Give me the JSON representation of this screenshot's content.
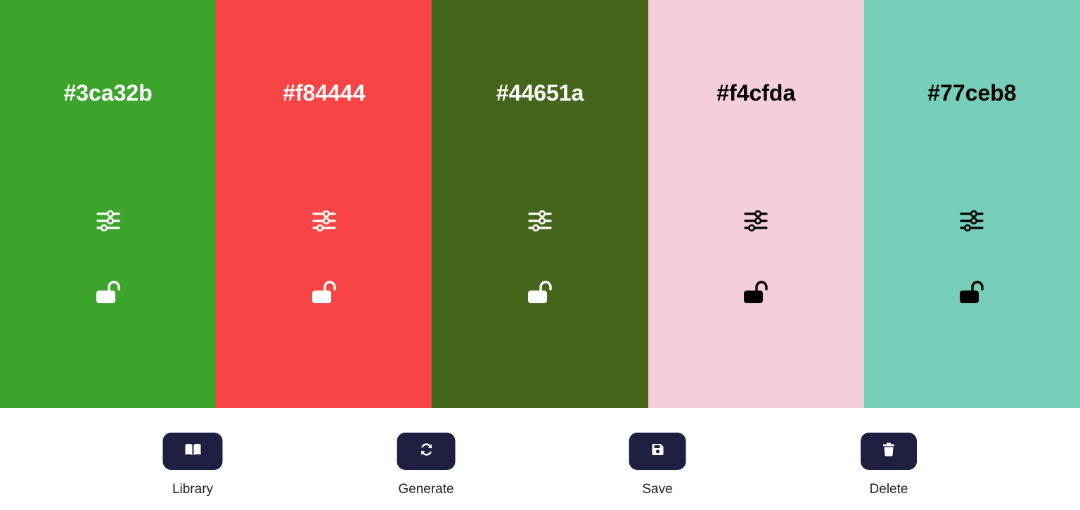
{
  "palette": {
    "swatches": [
      {
        "hex": "#3ca32b",
        "color": "#3ca32b",
        "text_color": "#ffffff",
        "adjust_icon": "sliders-icon",
        "lock_icon": "lock-open-icon"
      },
      {
        "hex": "#f84444",
        "color": "#f84444",
        "text_color": "#ffffff",
        "adjust_icon": "sliders-icon",
        "lock_icon": "lock-open-icon"
      },
      {
        "hex": "#44651a",
        "color": "#44651a",
        "text_color": "#ffffff",
        "adjust_icon": "sliders-icon",
        "lock_icon": "lock-open-icon"
      },
      {
        "hex": "#f4cfda",
        "color": "#f4cfda",
        "text_color": "#000000",
        "adjust_icon": "sliders-icon",
        "lock_icon": "lock-open-icon"
      },
      {
        "hex": "#77ceb8",
        "color": "#77ceb8",
        "text_color": "#000000",
        "adjust_icon": "sliders-icon",
        "lock_icon": "lock-open-icon"
      }
    ]
  },
  "toolbar": {
    "button_color": "#1f2041",
    "library": {
      "label": "Library",
      "icon": "book-open-icon"
    },
    "generate": {
      "label": "Generate",
      "icon": "refresh-icon"
    },
    "save": {
      "label": "Save",
      "icon": "floppy-disk-icon"
    },
    "delete": {
      "label": "Delete",
      "icon": "trash-icon"
    }
  }
}
